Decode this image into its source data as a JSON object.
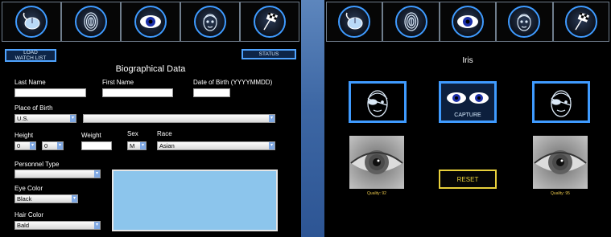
{
  "toolbar": {
    "icons": [
      "mouse-icon",
      "fingerprint-icon",
      "eye-icon",
      "face-icon",
      "checkered-flag-icon"
    ]
  },
  "left": {
    "load_watch_list": "LOAD\nWATCH LIST",
    "status": "STATUS",
    "title": "Biographical Data",
    "labels": {
      "last_name": "Last Name",
      "first_name": "First Name",
      "dob": "Date of Birth (YYYYMMDD)",
      "place_of_birth": "Place of Birth",
      "height": "Height",
      "weight": "Weight",
      "sex": "Sex",
      "race": "Race",
      "personnel_type": "Personnel Type",
      "eye_color": "Eye Color",
      "hair_color": "Hair Color"
    },
    "values": {
      "last_name": "",
      "first_name": "",
      "dob": "",
      "place_of_birth_country": "U.S.",
      "place_of_birth_region": "",
      "height_ft": "0",
      "height_in": "0",
      "weight": "",
      "sex": "M",
      "race": "Asian",
      "personnel_type": "",
      "eye_color": "Black",
      "hair_color": "Bald"
    }
  },
  "right": {
    "title": "Iris",
    "capture": "CAPTURE",
    "reset": "RESET",
    "quality_left": "Quality: 92",
    "quality_right": "Quality: 95"
  },
  "colors": {
    "accent": "#3f9bff",
    "panel_bg": "#000000",
    "reset_border": "#e9d13c",
    "quality_text": "#e6c44a",
    "bigbox_fill": "#8cc5ec"
  }
}
